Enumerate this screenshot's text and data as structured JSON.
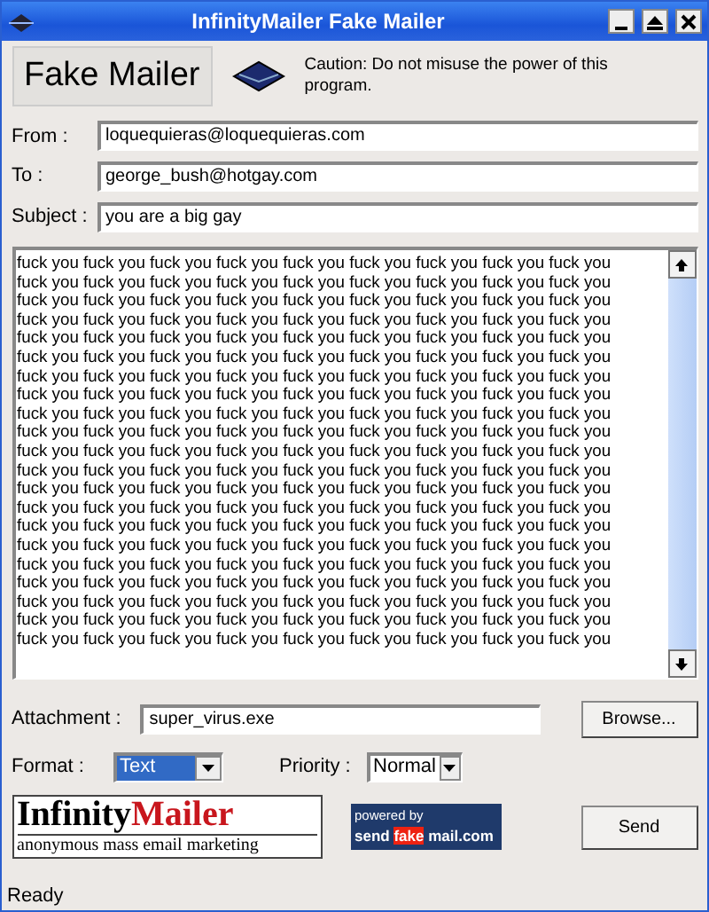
{
  "window": {
    "title": "InfinityMailer Fake Mailer"
  },
  "header": {
    "title": "Fake Mailer",
    "caution": "Caution: Do not misuse the power of this program."
  },
  "fields": [
    {
      "label": "From :",
      "value": "loquequieras@loquequieras.com"
    },
    {
      "label": "To :",
      "value": "george_bush@hotgay.com"
    },
    {
      "label": "Subject :",
      "value": "you are a big gay"
    }
  ],
  "body_lines": [
    "fuck you fuck you fuck you fuck you fuck you fuck you fuck you fuck you fuck you",
    "fuck you fuck you fuck you fuck you fuck you fuck you fuck you fuck you fuck you",
    "fuck you fuck you fuck you fuck you fuck you fuck you fuck you fuck you fuck you",
    "fuck you fuck you fuck you fuck you fuck you fuck you fuck you fuck you fuck you",
    "fuck you fuck you fuck you fuck you fuck you fuck you fuck you fuck you fuck you",
    "fuck you fuck you fuck you fuck you fuck you fuck you fuck you fuck you fuck you",
    "fuck you fuck you fuck you fuck you fuck you fuck you fuck you fuck you fuck you",
    "fuck you fuck you fuck you fuck you fuck you fuck you fuck you fuck you fuck you",
    "fuck you fuck you fuck you fuck you fuck you fuck you fuck you fuck you fuck you",
    "fuck you fuck you fuck you fuck you fuck you fuck you fuck you fuck you fuck you",
    "fuck you fuck you fuck you fuck you fuck you fuck you fuck you fuck you fuck you",
    "fuck you fuck you fuck you fuck you fuck you fuck you fuck you fuck you fuck you",
    "fuck you fuck you fuck you fuck you fuck you fuck you fuck you fuck you fuck you",
    "fuck you fuck you fuck you fuck you fuck you fuck you fuck you fuck you fuck you",
    "fuck you fuck you fuck you fuck you fuck you fuck you fuck you fuck you fuck you",
    "fuck you fuck you fuck you fuck you fuck you fuck you fuck you fuck you fuck you",
    "fuck you fuck you fuck you fuck you fuck you fuck you fuck you fuck you fuck you",
    "fuck you fuck you fuck you fuck you fuck you fuck you fuck you fuck you fuck you",
    "fuck you fuck you fuck you fuck you fuck you fuck you fuck you fuck you fuck you",
    "fuck you fuck you fuck you fuck you fuck you fuck you fuck you fuck you fuck you",
    "fuck you fuck you fuck you fuck you fuck you fuck you fuck you fuck you fuck you"
  ],
  "attachment": {
    "label": "Attachment :",
    "value": "super_virus.exe",
    "button": "Browse..."
  },
  "format": {
    "label": "Format :",
    "value": "Text",
    "focused": true
  },
  "priority": {
    "label": "Priority :",
    "value": "Normal",
    "focused": false
  },
  "logo": {
    "word1": "Infinity",
    "word2": "Mailer",
    "tagline": "anonymous mass email marketing"
  },
  "powered": {
    "line1": "powered by",
    "part1": "send",
    "part2": "fake",
    "part3": "mail.com"
  },
  "send_button": "Send",
  "status_bar": "Ready"
}
